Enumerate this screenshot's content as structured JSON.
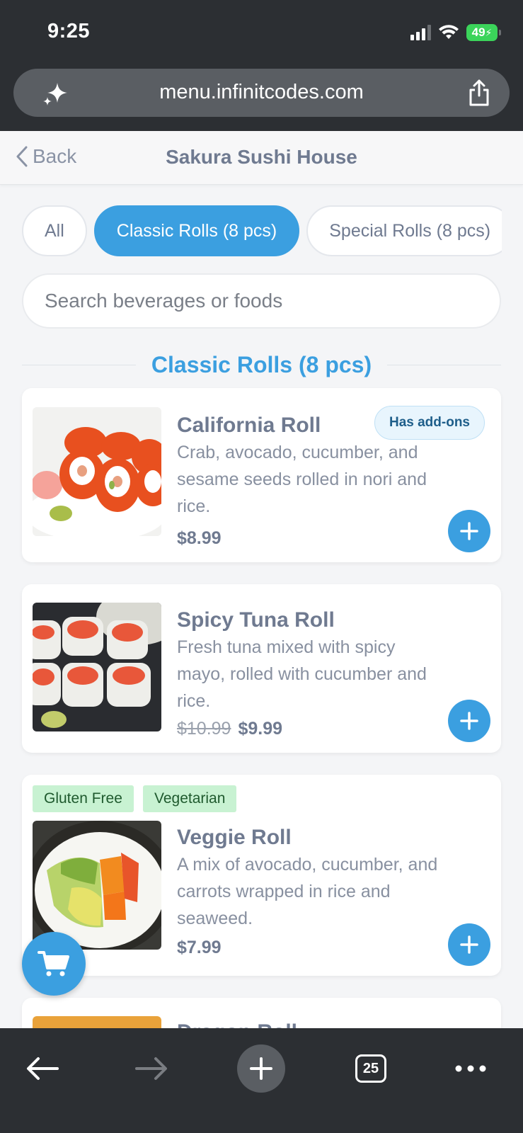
{
  "status": {
    "time": "9:25",
    "battery": "49"
  },
  "browser": {
    "url": "menu.infinitcodes.com",
    "tab_count": "25"
  },
  "header": {
    "back_label": "Back",
    "title": "Sakura Sushi House"
  },
  "categories": [
    {
      "label": "All",
      "active": false
    },
    {
      "label": "Classic Rolls (8 pcs)",
      "active": true
    },
    {
      "label": "Special Rolls (8 pcs)",
      "active": false
    }
  ],
  "search": {
    "placeholder": "Search beverages or foods"
  },
  "section": {
    "title": "Classic Rolls (8 pcs)"
  },
  "items": [
    {
      "name": "California Roll",
      "description": "Crab, avocado, cucumber, and sesame seeds rolled in nori and rice.",
      "price": "$8.99",
      "badge": "Has add-ons"
    },
    {
      "name": "Spicy Tuna Roll",
      "description": "Fresh tuna mixed with spicy mayo, rolled with cucumber and rice.",
      "old_price": "$10.99",
      "price": "$9.99"
    },
    {
      "name": "Veggie Roll",
      "description": "A mix of avocado, cucumber, and carrots wrapped in rice and seaweed.",
      "price": "$7.99",
      "tags": [
        "Gluten Free",
        "Vegetarian"
      ]
    },
    {
      "name": "Dragon Roll"
    }
  ],
  "colors": {
    "accent": "#3b9fe0",
    "chrome": "#2c2f33",
    "tag_bg": "#c8f2d2"
  }
}
